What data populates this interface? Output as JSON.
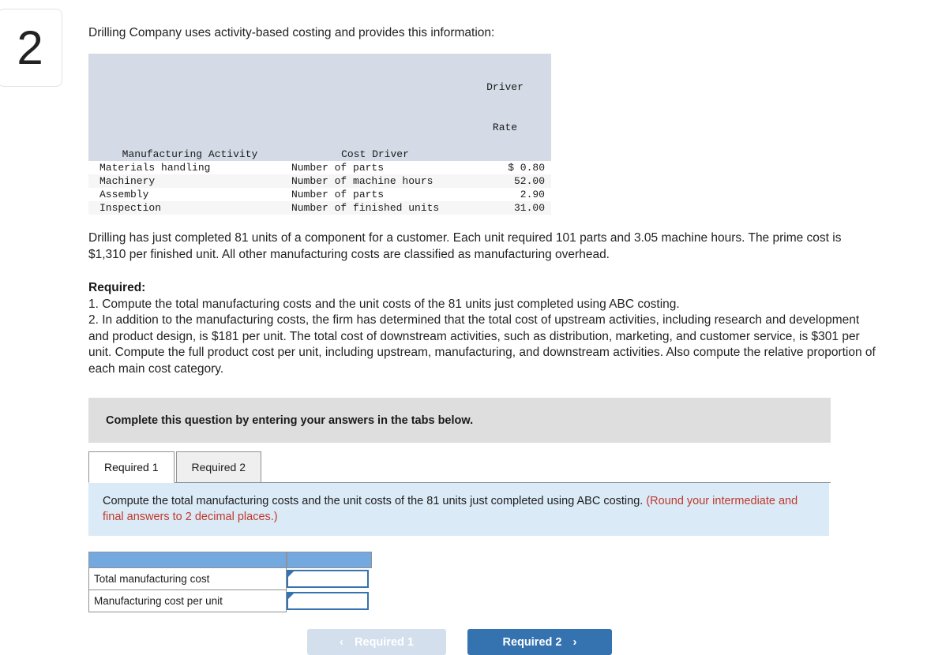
{
  "question": {
    "number": "2",
    "intro": "Drilling Company uses activity-based costing and provides this information:"
  },
  "driver_table": {
    "headers": {
      "activity": "Manufacturing Activity",
      "cost_driver": "Cost Driver",
      "driver_rate_line1": "Driver",
      "driver_rate_line2": "Rate"
    },
    "rows": [
      {
        "activity": "Materials handling",
        "cost_driver": "Number of parts",
        "rate": "$ 0.80"
      },
      {
        "activity": "Machinery",
        "cost_driver": "Number of machine hours",
        "rate": "52.00"
      },
      {
        "activity": "Assembly",
        "cost_driver": "Number of parts",
        "rate": "2.90"
      },
      {
        "activity": "Inspection",
        "cost_driver": "Number of finished units",
        "rate": "31.00"
      }
    ]
  },
  "scenario": "Drilling has just completed 81 units of a component for a customer. Each unit required 101 parts and 3.05 machine hours. The prime cost is $1,310 per finished unit. All other manufacturing costs are classified as manufacturing overhead.",
  "required": {
    "heading": "Required:",
    "item1": "1. Compute the total manufacturing costs and the unit costs of the 81 units just completed using ABC costing.",
    "item2": "2. In addition to the manufacturing costs, the firm has determined that the total cost of upstream activities, including research and development and product design, is $181 per unit. The total cost of downstream activities, such as distribution, marketing, and customer service, is $301 per unit. Compute the full product cost per unit, including upstream, manufacturing, and downstream activities. Also compute the relative proportion of each main cost category."
  },
  "answer_banner": "Complete this question by entering your answers in the tabs below.",
  "tabs": [
    {
      "label": "Required 1",
      "active": true
    },
    {
      "label": "Required 2",
      "active": false
    }
  ],
  "tab_instructions": {
    "main": "Compute the total manufacturing costs and the unit costs of the 81 units just completed using ABC costing. ",
    "round_note": "(Round your intermediate and final answers to 2 decimal places.)"
  },
  "answer_table": {
    "rows": [
      {
        "label": "Total manufacturing cost",
        "value": ""
      },
      {
        "label": "Manufacturing cost per unit",
        "value": ""
      }
    ]
  },
  "nav": {
    "prev_label": "Required 1",
    "next_label": "Required 2",
    "prev_chevron": "‹",
    "next_chevron": "›"
  },
  "colors": {
    "header_blue": "#74a9e0",
    "button_blue": "#3572b0",
    "button_disabled": "#d3dfec",
    "banner_grey": "#dedede",
    "panel_blue": "#dbeaf7",
    "round_note_red": "#c0392b",
    "table_header_grey": "#d4dae6"
  }
}
